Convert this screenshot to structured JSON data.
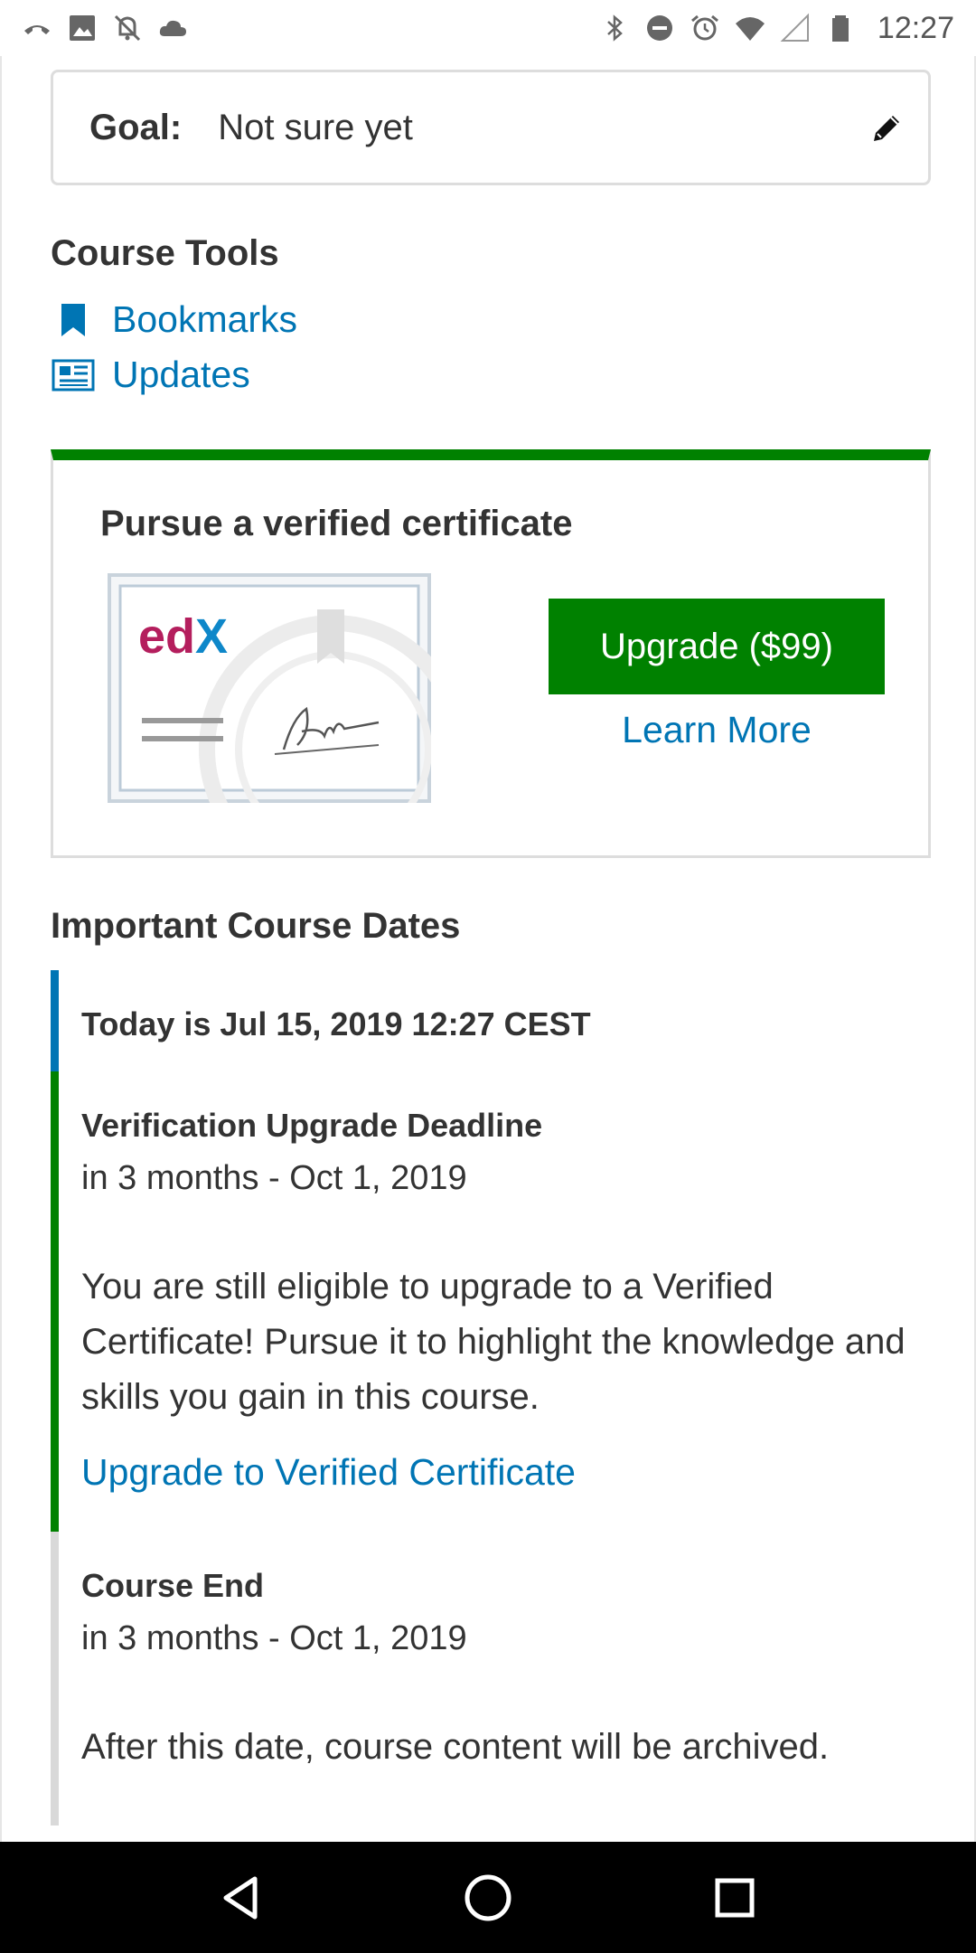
{
  "status_bar": {
    "time": "12:27",
    "left_icons": [
      "phone-missed-icon",
      "image-icon",
      "notifications-off-icon",
      "cloud-icon"
    ],
    "right_icons": [
      "bluetooth-icon",
      "do-not-disturb-icon",
      "alarm-icon",
      "wifi-icon",
      "signal-icon",
      "battery-icon"
    ]
  },
  "goal": {
    "label": "Goal:",
    "value": "Not sure yet",
    "edit_icon": "pencil-icon"
  },
  "course_tools": {
    "title": "Course Tools",
    "items": [
      {
        "label": "Bookmarks",
        "icon": "bookmark-icon"
      },
      {
        "label": "Updates",
        "icon": "newspaper-icon"
      }
    ]
  },
  "certificate": {
    "title": "Pursue a verified certificate",
    "upgrade_label": "Upgrade ($99)",
    "learn_more_label": "Learn More",
    "logo_text": "edX",
    "accent_color": "#008100"
  },
  "important_dates": {
    "title": "Important Course Dates",
    "today": "Today is Jul 15, 2019 12:27 CEST",
    "items": [
      {
        "title": "Verification Upgrade Deadline",
        "when": "in 3 months - Oct 1, 2019",
        "description": "You are still eligible to upgrade to a Verified Certificate! Pursue it to highlight the knowledge and skills you gain in this course.",
        "link": "Upgrade to Verified Certificate"
      },
      {
        "title": "Course End",
        "when": "in 3 months - Oct 1, 2019",
        "description": "After this date, course content will be archived."
      }
    ]
  },
  "nav_bar": {
    "buttons": [
      "back-icon",
      "home-icon",
      "recents-icon"
    ]
  },
  "colors": {
    "link": "#0075b4",
    "green": "#008100",
    "text": "#333333"
  }
}
